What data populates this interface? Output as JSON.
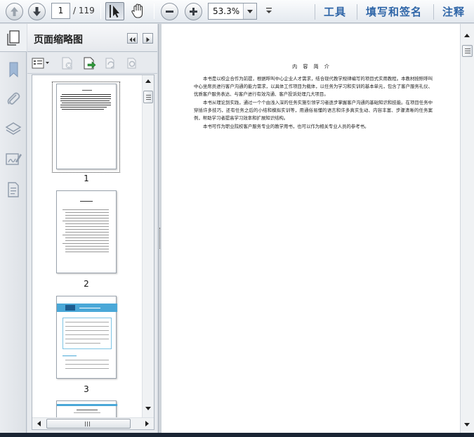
{
  "toolbar": {
    "current_page": "1",
    "total_pages": "/ 119",
    "zoom": "53.3%",
    "menus": [
      "工具",
      "填写和签名",
      "注释"
    ]
  },
  "panel": {
    "title": "页面缩略图",
    "thumbnails": [
      {
        "label": "1"
      },
      {
        "label": "2"
      },
      {
        "label": "3"
      }
    ]
  },
  "document": {
    "title": "内 容 简 介",
    "paragraphs": [
      "本书是以校企合作为前提，根据呼叫中心企业人才需求，结合现代教学规律编写的项目式实用教程。本教材按照呼叫中心坐席员进行客户沟通的能力需求，以具体工作项目为载体，以任务为学习和实训的基本单元，包含了客户服务礼仪、优质客户服务表达、与客户进行有效沟通、客户投诉处理几大项目。",
      "本书从理论到实践，通过一个个由浅入深的任务实施引领学习者逐步掌握客户沟通的基础知识和技能。在项目任务中穿插许多技巧，还有任务之后的小结和模拟实训等，用通俗易懂的语言和许多真实生动、内容丰富、步骤清晰的任务案例，帮助学习者提高学习效率和扩展知识结构。",
      "本书可作为职业院校客户服务专业的教学用书，也可以作为相关专业人员的参考书。"
    ]
  },
  "colors": {
    "accent": "#2e65a7",
    "thumb3_banner": "#4aa8d8"
  }
}
